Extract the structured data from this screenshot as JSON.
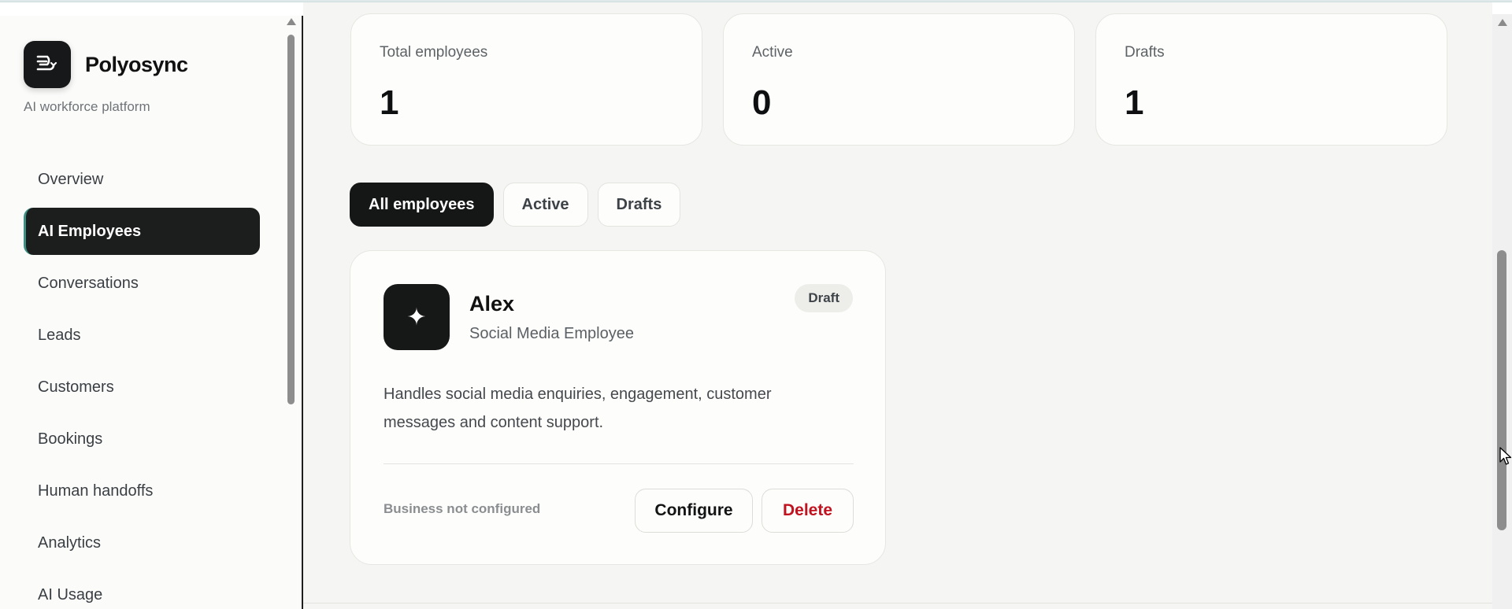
{
  "brand": {
    "name": "Polyosync",
    "tagline": "AI workforce platform",
    "logo_icon": "polyosync-logo-icon"
  },
  "sidebar": {
    "items": [
      {
        "label": "Overview",
        "active": false
      },
      {
        "label": "AI Employees",
        "active": true
      },
      {
        "label": "Conversations",
        "active": false
      },
      {
        "label": "Leads",
        "active": false
      },
      {
        "label": "Customers",
        "active": false
      },
      {
        "label": "Bookings",
        "active": false
      },
      {
        "label": "Human handoffs",
        "active": false
      },
      {
        "label": "Analytics",
        "active": false
      },
      {
        "label": "AI Usage",
        "active": false
      }
    ]
  },
  "stats": [
    {
      "label": "Total employees",
      "value": "1"
    },
    {
      "label": "Active",
      "value": "0"
    },
    {
      "label": "Drafts",
      "value": "1"
    }
  ],
  "tabs": [
    {
      "label": "All employees",
      "active": true
    },
    {
      "label": "Active",
      "active": false
    },
    {
      "label": "Drafts",
      "active": false
    }
  ],
  "employee_card": {
    "name": "Alex",
    "role": "Social Media Employee",
    "status": "Draft",
    "avatar_icon": "sparkle-icon",
    "avatar_glyph": "✦",
    "description": "Handles social media enquiries, engagement, customer messages and content support.",
    "business_status": "Business not configured",
    "configure_label": "Configure",
    "delete_label": "Delete"
  },
  "colors": {
    "sidebar_active_bg": "#1b1e1c",
    "accent_teal": "#3f8f84",
    "delete_red": "#c1121f",
    "main_bg": "#f5f5f3"
  }
}
